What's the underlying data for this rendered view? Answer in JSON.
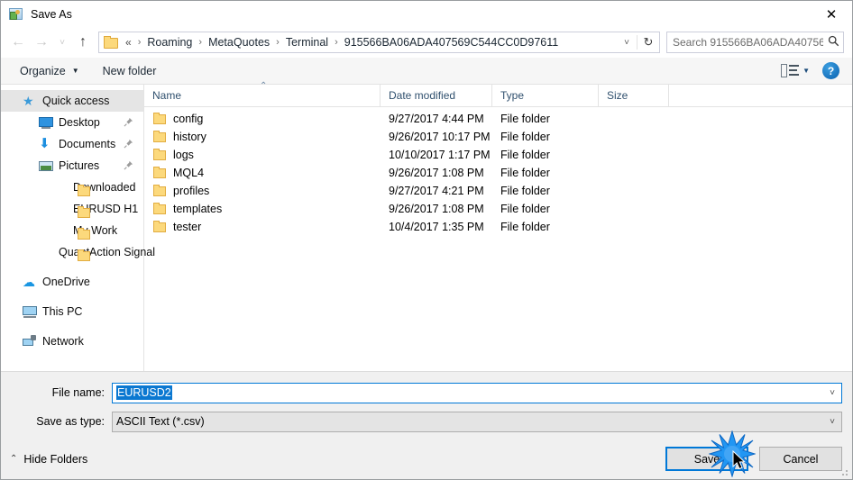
{
  "window": {
    "title": "Save As",
    "icon": "app-icon",
    "close_label": "✕"
  },
  "address": {
    "back_icon": "←",
    "forward_icon": "→",
    "recent_icon": "˅",
    "up_icon": "↑",
    "separator": "›",
    "prefix": "«",
    "crumbs": [
      "Roaming",
      "MetaQuotes",
      "Terminal",
      "915566BA06ADA407569C544CC0D97611"
    ],
    "dropdown_icon": "˅",
    "refresh_icon": "↻"
  },
  "search": {
    "placeholder": "Search 915566BA06ADA40756...",
    "icon": "search-icon"
  },
  "toolbar": {
    "organize_label": "Organize",
    "organize_caret": "▼",
    "new_folder_label": "New folder",
    "view_caret": "▼",
    "help_label": "?"
  },
  "sidebar": {
    "items": [
      {
        "label": "Quick access",
        "icon": "star-icon",
        "selected": true,
        "indent": false,
        "pinned": false
      },
      {
        "label": "Desktop",
        "icon": "desktop-icon",
        "selected": false,
        "indent": true,
        "pinned": true
      },
      {
        "label": "Documents",
        "icon": "documents-icon",
        "selected": false,
        "indent": true,
        "pinned": true
      },
      {
        "label": "Pictures",
        "icon": "pictures-icon",
        "selected": false,
        "indent": true,
        "pinned": true
      },
      {
        "label": "Downloaded",
        "icon": "folder-icon",
        "selected": false,
        "indent": true,
        "pinned": false
      },
      {
        "label": "EURUSD H1",
        "icon": "folder-icon",
        "selected": false,
        "indent": true,
        "pinned": false
      },
      {
        "label": "My Work",
        "icon": "folder-icon",
        "selected": false,
        "indent": true,
        "pinned": false
      },
      {
        "label": "QuantAction Signal",
        "icon": "folder-icon",
        "selected": false,
        "indent": true,
        "pinned": false
      },
      {
        "label": "OneDrive",
        "icon": "onedrive-icon",
        "selected": false,
        "indent": false,
        "pinned": false
      },
      {
        "label": "This PC",
        "icon": "thispc-icon",
        "selected": false,
        "indent": false,
        "pinned": false
      },
      {
        "label": "Network",
        "icon": "network-icon",
        "selected": false,
        "indent": false,
        "pinned": false
      }
    ],
    "pin_glyph": "📌"
  },
  "filelist": {
    "columns": {
      "name": "Name",
      "date_modified": "Date modified",
      "type": "Type",
      "size": "Size"
    },
    "sort_indicator": "⌃",
    "rows": [
      {
        "name": "config",
        "date": "9/27/2017 4:44 PM",
        "type": "File folder",
        "size": ""
      },
      {
        "name": "history",
        "date": "9/26/2017 10:17 PM",
        "type": "File folder",
        "size": ""
      },
      {
        "name": "logs",
        "date": "10/10/2017 1:17 PM",
        "type": "File folder",
        "size": ""
      },
      {
        "name": "MQL4",
        "date": "9/26/2017 1:08 PM",
        "type": "File folder",
        "size": ""
      },
      {
        "name": "profiles",
        "date": "9/27/2017 4:21 PM",
        "type": "File folder",
        "size": ""
      },
      {
        "name": "templates",
        "date": "9/26/2017 1:08 PM",
        "type": "File folder",
        "size": ""
      },
      {
        "name": "tester",
        "date": "10/4/2017 1:35 PM",
        "type": "File folder",
        "size": ""
      }
    ]
  },
  "form": {
    "filename_label": "File name:",
    "filename_value": "EURUSD2",
    "filetype_label": "Save as type:",
    "filetype_value": "ASCII Text (*.csv)",
    "dropdown_icon": "˅"
  },
  "footer": {
    "hide_folders_label": "Hide Folders",
    "hide_folders_caret": "⌃",
    "save_label": "Save",
    "cancel_label": "Cancel"
  },
  "colors": {
    "accent": "#0078d7",
    "selection": "#0b78d1",
    "folder": "#fcd97c",
    "window_bg": "#f0f0f0"
  }
}
